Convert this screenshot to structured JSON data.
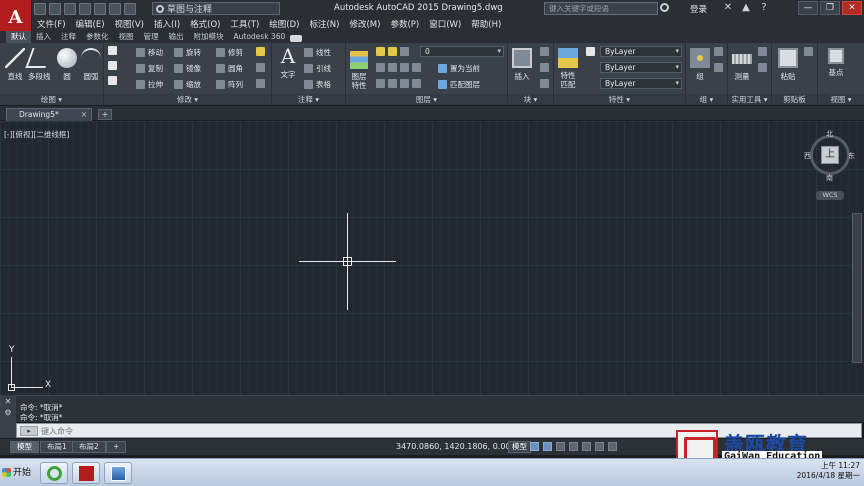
{
  "window": {
    "app_logo": "A",
    "workspace": "草图与注释",
    "title": "Autodesk AutoCAD 2015    Drawing5.dwg",
    "search_placeholder": "键入关键字或短语",
    "login": "登录",
    "controls": [
      "—",
      "❐",
      "✕"
    ]
  },
  "menu": [
    "文件(F)",
    "编辑(E)",
    "视图(V)",
    "插入(I)",
    "格式(O)",
    "工具(T)",
    "绘图(D)",
    "标注(N)",
    "修改(M)",
    "参数(P)",
    "窗口(W)",
    "帮助(H)"
  ],
  "ribbon_tabs": [
    "默认",
    "插入",
    "注释",
    "参数化",
    "视图",
    "管理",
    "输出",
    "附加模块",
    "Autodesk 360"
  ],
  "ribbon": {
    "draw": {
      "title": "绘图 ▾",
      "line": "直线",
      "polyline": "多段线",
      "circle": "圆",
      "arc": "圆弧"
    },
    "modify": {
      "title": "修改 ▾",
      "move": "移动",
      "rotate": "旋转",
      "trim": "修剪",
      "copy": "复制",
      "mirror": "镜像",
      "fillet": "圆角",
      "stretch": "拉伸",
      "scale": "缩放",
      "array": "阵列"
    },
    "annotation": {
      "title": "注释 ▾",
      "text": "文字",
      "dim": "线性",
      "leader": "引线",
      "table": "表格"
    },
    "layers": {
      "title": "图层 ▾",
      "props": "图层\n特性",
      "current_layer": "0",
      "make_current": "置为当前",
      "match": "匹配图层"
    },
    "block": {
      "title": "块 ▾",
      "insert": "插入"
    },
    "properties": {
      "title": "特性 ▾",
      "match_props": "特性\n匹配",
      "color": "ByLayer",
      "linetype": "ByLayer",
      "lineweight": "ByLayer"
    },
    "groups": {
      "title": "组 ▾",
      "group": "组"
    },
    "utilities": {
      "title": "实用工具 ▾",
      "measure": "测量"
    },
    "clipboard": {
      "title": "剪贴板",
      "paste": "粘贴"
    },
    "view": {
      "title": "视图 ▾",
      "base": "基点"
    }
  },
  "file_tab": {
    "name": "Drawing5*",
    "close": "×",
    "new": "+"
  },
  "canvas": {
    "viewport_label": "[-][俯视][二维线框]",
    "viewcube": {
      "top": "上",
      "north": "北",
      "south": "南",
      "west": "西",
      "east": "东",
      "wcs": "WCS"
    },
    "ucs": {
      "x": "X",
      "y": "Y"
    }
  },
  "command": {
    "history": [
      "命令: *取消*",
      "命令: *取消*"
    ],
    "placeholder": "键入命令"
  },
  "layout_tabs": [
    "模型",
    "布局1",
    "布局2",
    "+"
  ],
  "status": {
    "coords": "3470.0860, 1420.1806, 0.0000",
    "mode": "模型"
  },
  "watermark": {
    "cn": "盖瓯教育",
    "en": "GaiWan Education"
  },
  "taskbar": {
    "start": "开始",
    "time": "上午 11:27",
    "date": "2016/4/18 星期一"
  }
}
